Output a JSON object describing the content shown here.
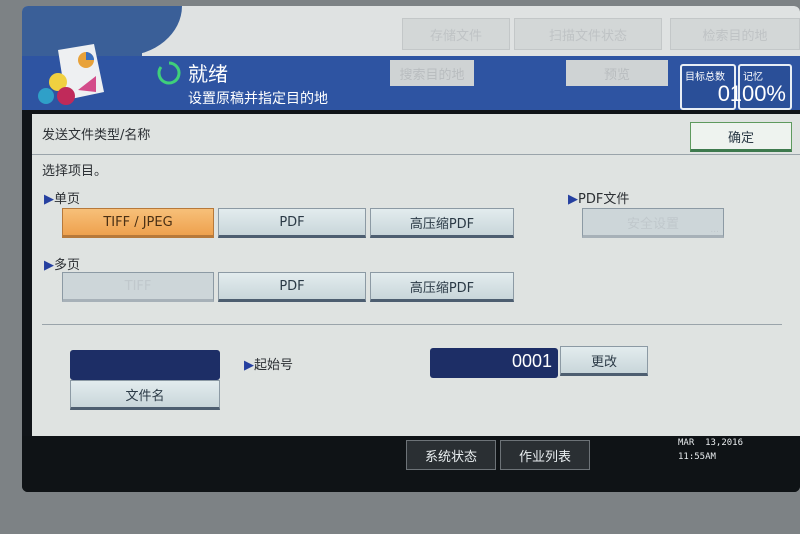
{
  "top_buttons": [
    "存储文件",
    "扫描文件状态",
    "检索目的地"
  ],
  "status": {
    "title": "就绪",
    "subtitle": "设置原稿并指定目的地"
  },
  "header_buttons": {
    "search_destination": "搜索目的地",
    "preview": "预览"
  },
  "counters": {
    "total_label": "目标总数",
    "total_value": "0",
    "memory_label": "记忆",
    "memory_value": "100%"
  },
  "panel": {
    "title": "发送文件类型/名称",
    "ok": "确定",
    "instruction": "选择项目。"
  },
  "single_page": {
    "label": "单页",
    "options": [
      "TIFF / JPEG",
      "PDF",
      "高压缩PDF"
    ],
    "selected": "TIFF / JPEG"
  },
  "multi_page": {
    "label": "多页",
    "options": [
      "TIFF",
      "PDF",
      "高压缩PDF"
    ]
  },
  "pdf_file": {
    "label": "PDF文件",
    "security": "安全设置",
    "ellipsis": "..."
  },
  "file_name": {
    "button": "文件名",
    "value": ""
  },
  "start_number": {
    "label": "起始号",
    "value": "0001",
    "change": "更改"
  },
  "footer": {
    "system_status": "系统状态",
    "job_list": "作业列表",
    "date": "MAR  13,2016",
    "time": "11:55AM"
  },
  "colors": {
    "header_blue": "#2e54a2",
    "selected_orange": "#f0a552",
    "field_navy": "#1d2e66"
  }
}
